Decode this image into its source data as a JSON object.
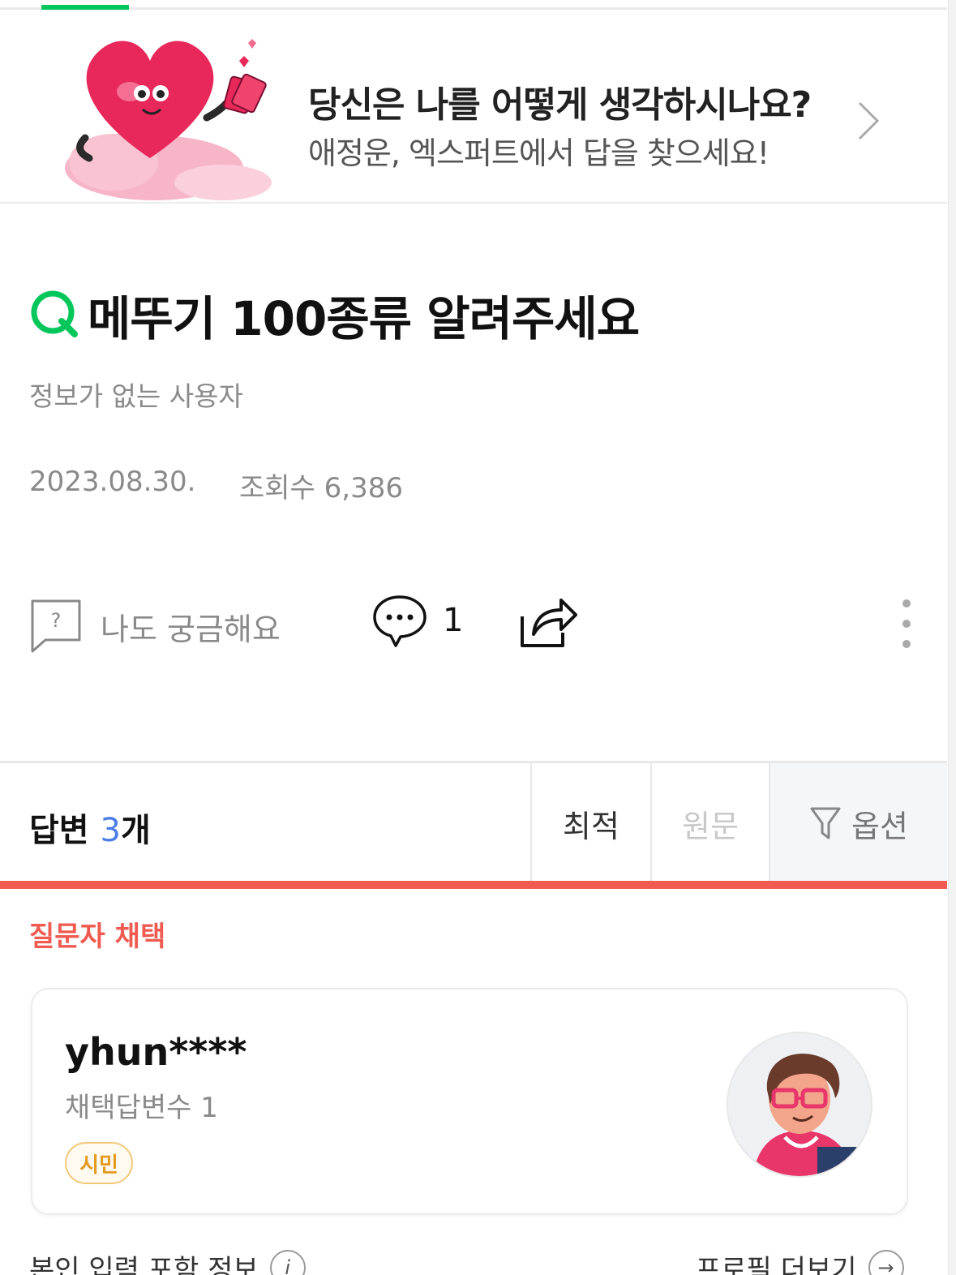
{
  "banner": {
    "title": "당신은 나를 어떻게 생각하시나요?",
    "subtitle": "애정운, 엑스퍼트에서 답을 찾으세요!",
    "accent_color": "#e8285a"
  },
  "question": {
    "prefix_icon": "q-icon",
    "title": "메뚜기 100종류 알려주세요",
    "asker": "정보가 없는 사용자",
    "date": "2023.08.30.",
    "views": "조회수 6,386"
  },
  "actions": {
    "curious_label": "나도 궁금해요",
    "comment_count": "1"
  },
  "answers": {
    "label": "답변",
    "count": "3",
    "unit": "개",
    "sort_best": "최적",
    "sort_original": "원문",
    "options": "옵션"
  },
  "chosen": {
    "label": "질문자 채택",
    "username": "yhun****",
    "adopted_count": "채택답변수 1",
    "badge": "시민"
  },
  "footer": {
    "left_text": "본인 입력 포함 정보",
    "right_text": "프로필 더보기"
  },
  "colors": {
    "brand_green": "#03c75a",
    "highlight_red": "#f05a50",
    "count_blue": "#4a7ee6"
  }
}
